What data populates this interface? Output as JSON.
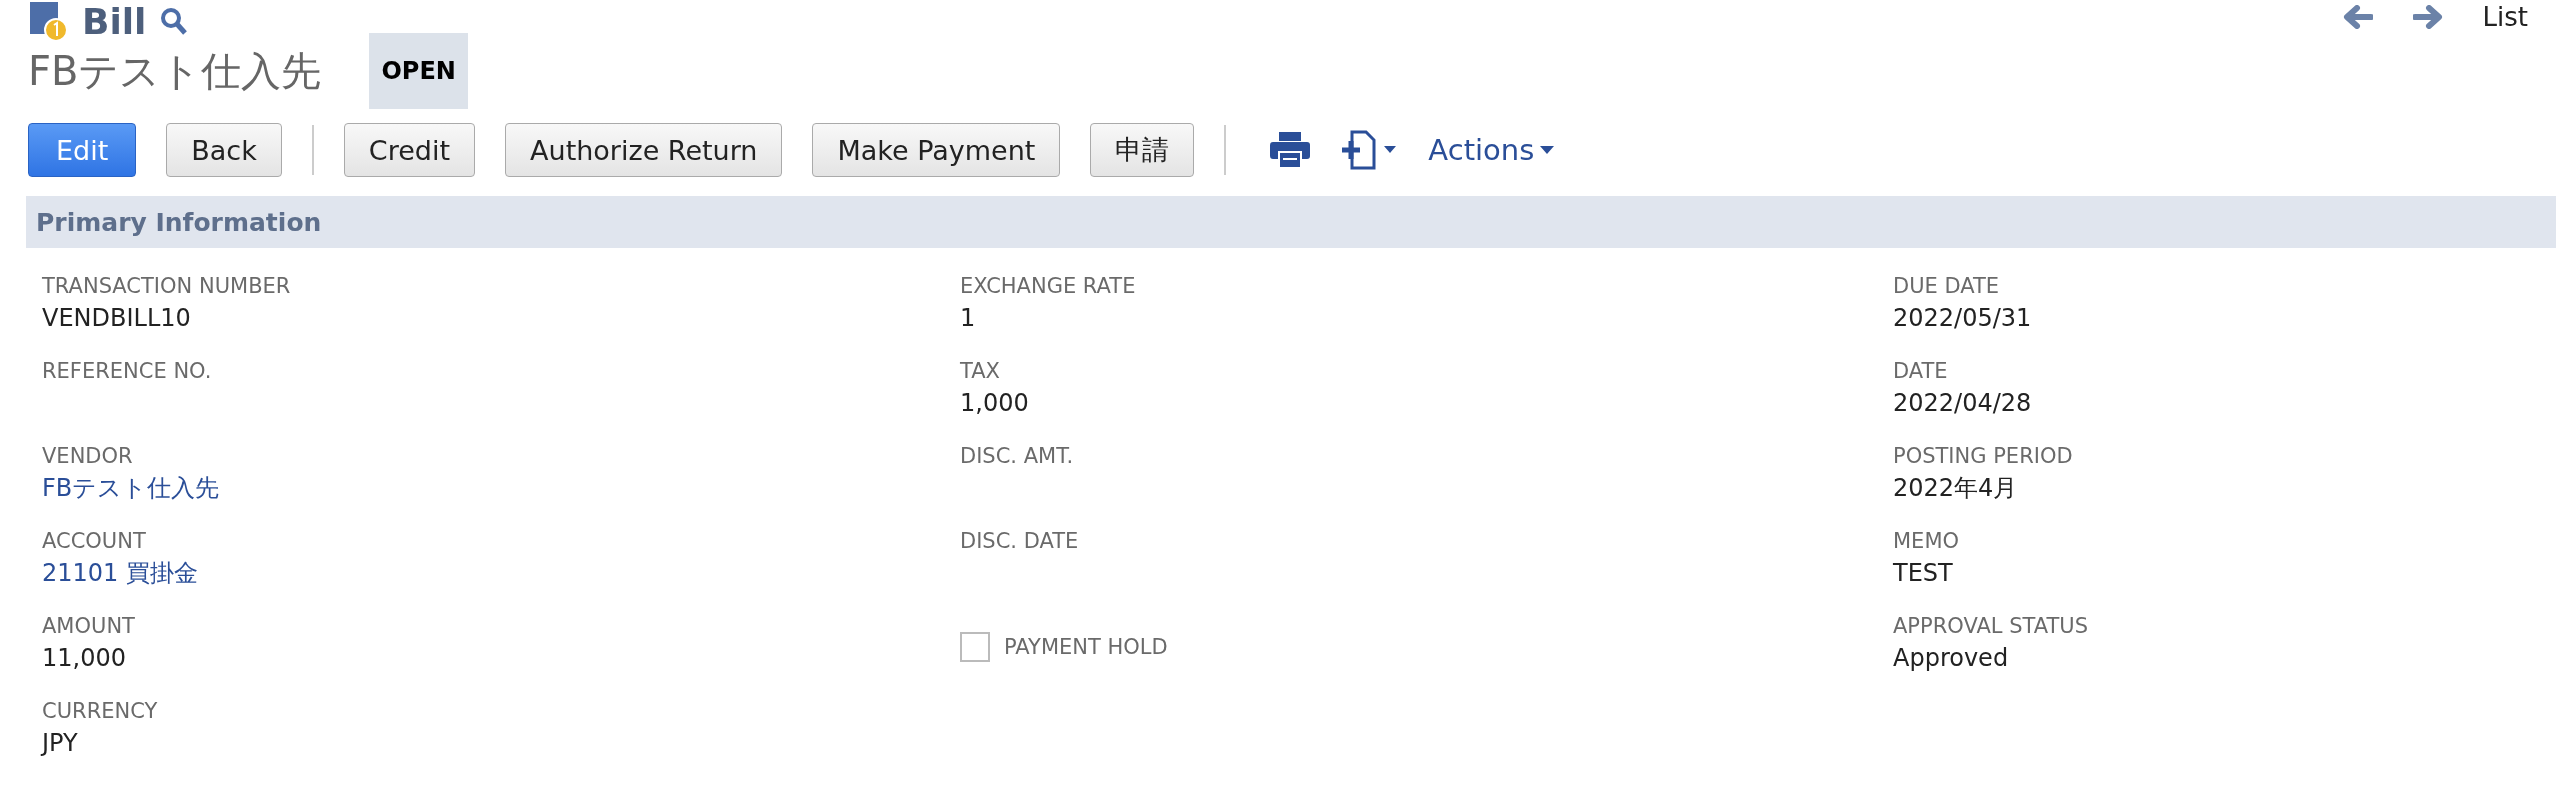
{
  "header": {
    "record_type": "Bill",
    "nav": {
      "list_link": "List"
    }
  },
  "title": {
    "name": "FBテスト仕入先",
    "status": "OPEN"
  },
  "toolbar": {
    "button_groups": [
      [
        {
          "label": "Edit",
          "kind": "primary"
        },
        {
          "label": "Back",
          "kind": "normal"
        }
      ],
      [
        {
          "label": "Credit",
          "kind": "normal"
        },
        {
          "label": "Authorize Return",
          "kind": "normal"
        },
        {
          "label": "Make Payment",
          "kind": "normal"
        },
        {
          "label": "申請",
          "kind": "normal"
        }
      ]
    ],
    "actions_label": "Actions"
  },
  "section": {
    "title": "Primary Information",
    "columns": [
      [
        {
          "label": "TRANSACTION NUMBER",
          "value": "VENDBILL10",
          "kind": "text"
        },
        {
          "label": "REFERENCE NO.",
          "kind": "text"
        },
        {
          "label": "VENDOR",
          "value": "FBテスト仕入先",
          "kind": "link"
        },
        {
          "label": "ACCOUNT",
          "value": "21101 買掛金",
          "kind": "link"
        },
        {
          "label": "AMOUNT",
          "value": "11,000",
          "kind": "text"
        },
        {
          "label": "CURRENCY",
          "value": "JPY",
          "kind": "text"
        }
      ],
      [
        {
          "label": "EXCHANGE RATE",
          "value": "1",
          "kind": "text"
        },
        {
          "label": "TAX",
          "value": "1,000",
          "kind": "text"
        },
        {
          "label": "DISC. AMT.",
          "kind": "text"
        },
        {
          "label": "DISC. DATE",
          "kind": "text"
        },
        {
          "label": "PAYMENT HOLD",
          "kind": "checkbox",
          "checked": false
        }
      ],
      [
        {
          "label": "DUE DATE",
          "value": "2022/05/31",
          "kind": "text"
        },
        {
          "label": "DATE",
          "value": "2022/04/28",
          "kind": "text"
        },
        {
          "label": "POSTING PERIOD",
          "value": "2022年4月",
          "kind": "text"
        },
        {
          "label": "MEMO",
          "value": "TEST",
          "kind": "text"
        },
        {
          "label": "APPROVAL STATUS",
          "value": "Approved",
          "kind": "text"
        }
      ]
    ]
  }
}
